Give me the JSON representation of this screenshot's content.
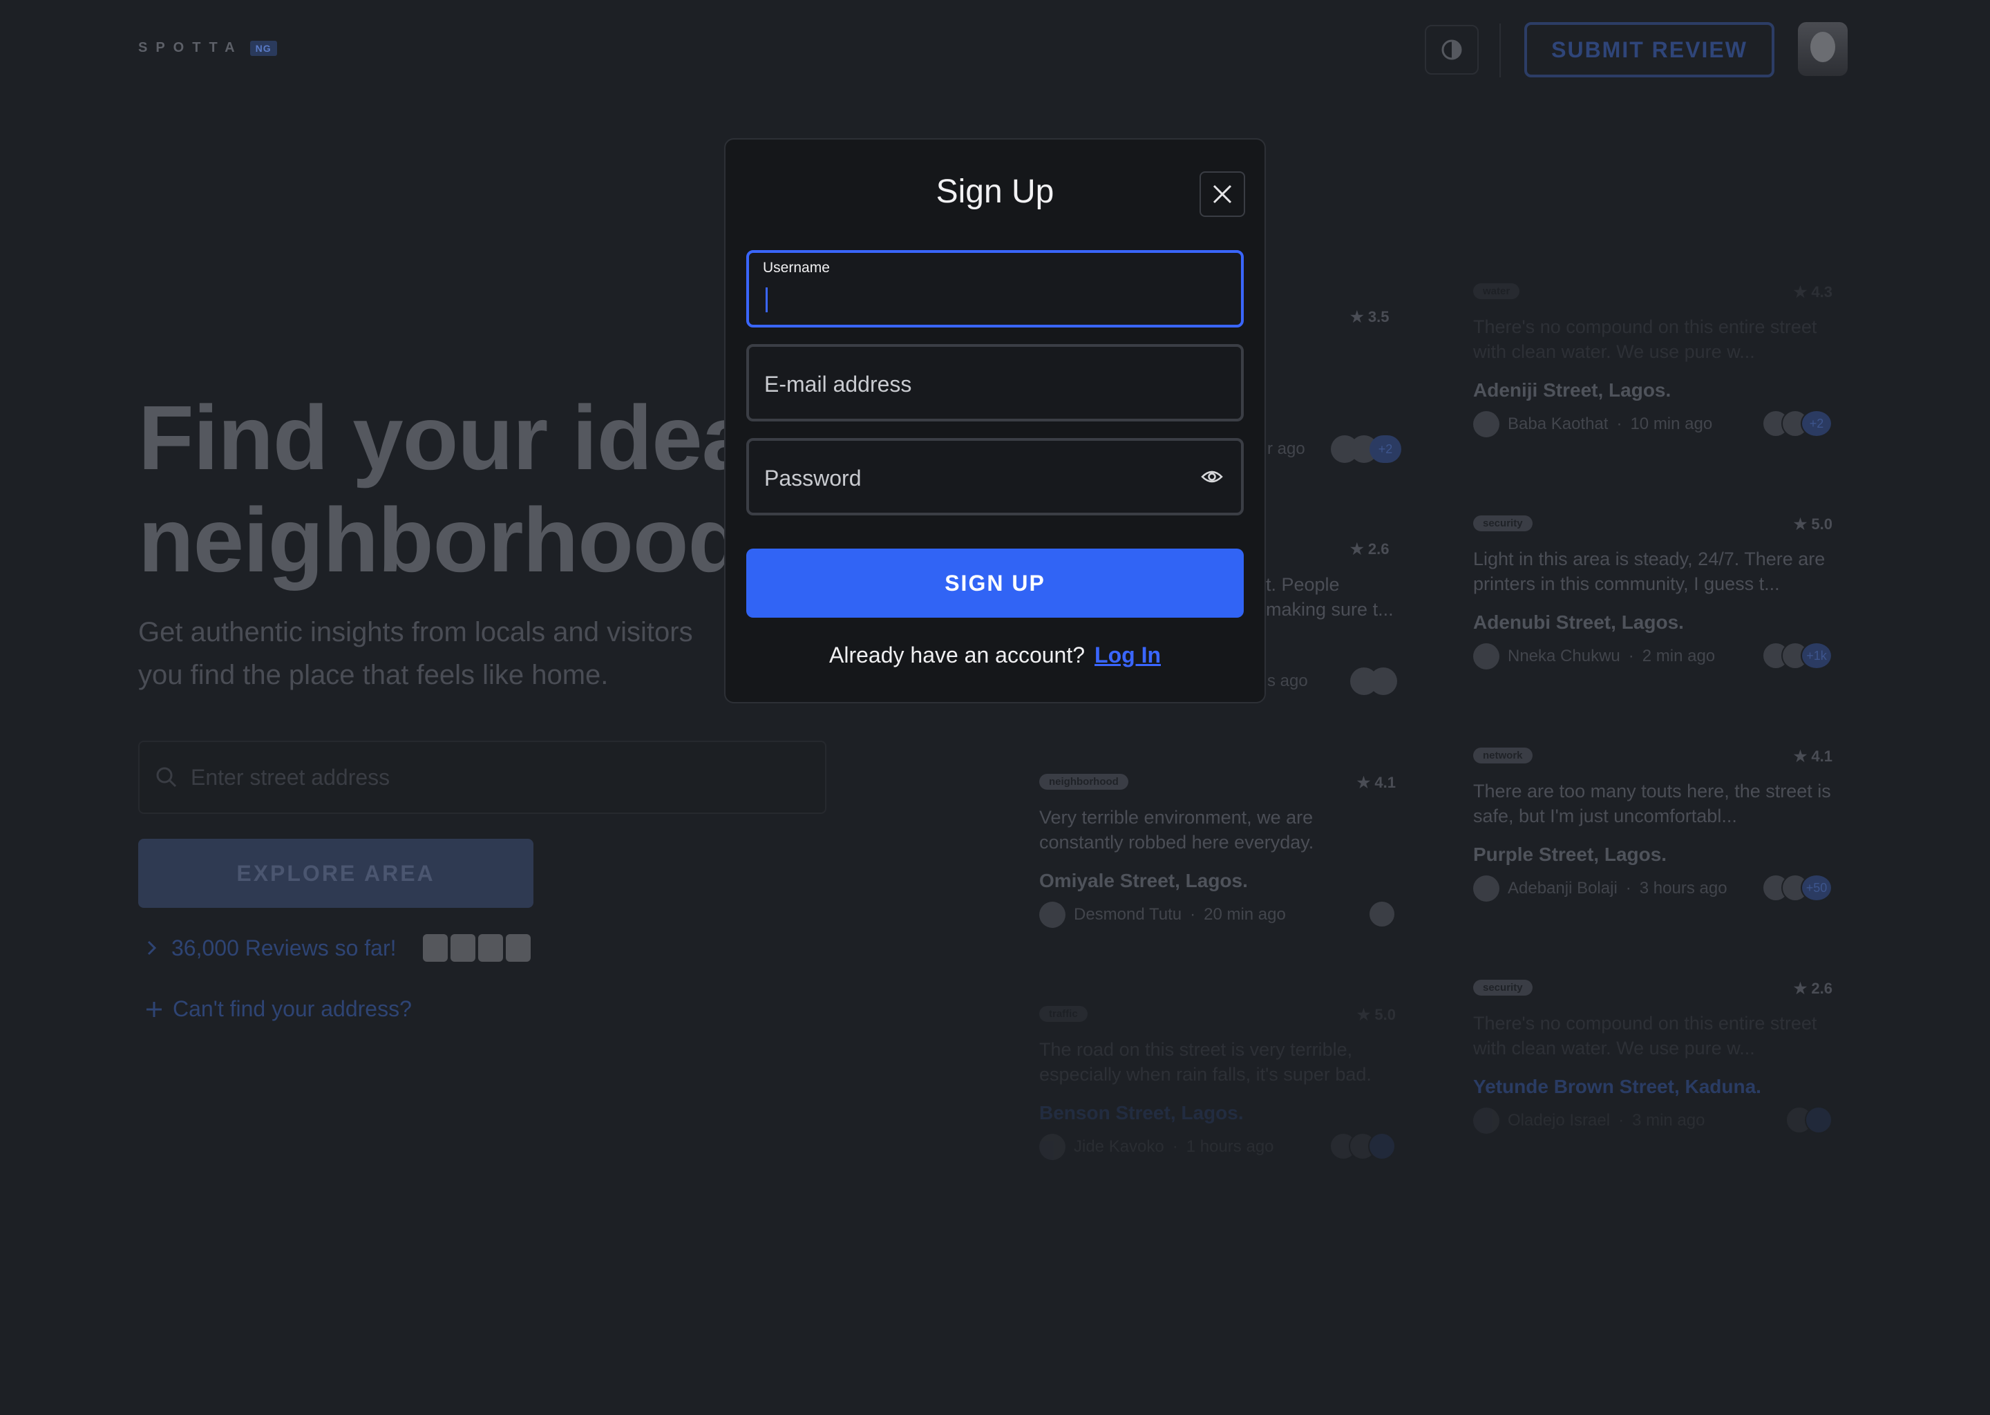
{
  "header": {
    "logo_text": "SPOTTA",
    "logo_tag": "NG",
    "submit_review": "SUBMIT REVIEW"
  },
  "hero": {
    "title_line1": "Find your ideal",
    "title_line2": "neighborhood",
    "subtitle_line1": "Get authentic insights from locals and visitors",
    "subtitle_line2": "you find the place that feels like home.",
    "search_placeholder": "Enter street address",
    "explore_button": "EXPLORE AREA",
    "reviews_count": "36,000 Reviews so far!",
    "cant_find": "Can't find your address?"
  },
  "reviews_middle": [
    {
      "badge": "",
      "rating": "3.5",
      "text": "",
      "street": "",
      "author": "",
      "time": "r ago",
      "extra": "+2"
    },
    {
      "badge": "",
      "rating": "2.6",
      "text": "t. People making sure t...",
      "street": "",
      "author": "",
      "time": "s ago",
      "extra": ""
    },
    {
      "badge": "neighborhood",
      "rating": "4.1",
      "text": "Very terrible environment, we are constantly robbed here everyday.",
      "street": "Omiyale Street, Lagos.",
      "author": "Desmond Tutu",
      "time": "20 min ago",
      "extra": ""
    },
    {
      "badge": "traffic",
      "rating": "5.0",
      "text": "The road on this street is very terrible, especially when rain falls, it's super bad.",
      "street": "Benson Street, Lagos.",
      "author": "Jide Kavoko",
      "time": "1 hours ago",
      "extra": ""
    }
  ],
  "reviews_right": [
    {
      "badge": "water",
      "rating": "4.3",
      "text": "There's no compound on this entire street with clean water. We use pure w...",
      "street": "Adeniji Street, Lagos.",
      "author": "Baba Kaothat",
      "time": "10 min ago",
      "extra": "+2"
    },
    {
      "badge": "security",
      "rating": "5.0",
      "text": "Light in this area is steady, 24/7. There are printers in this community, I guess t...",
      "street": "Adenubi Street, Lagos.",
      "author": "Nneka Chukwu",
      "time": "2 min ago",
      "extra": "+1k"
    },
    {
      "badge": "network",
      "rating": "4.1",
      "text": "There are too many touts here, the street is safe, but I'm just uncomfortabl...",
      "street": "Purple Street, Lagos.",
      "author": "Adebanji Bolaji",
      "time": "3 hours ago",
      "extra": "+50"
    },
    {
      "badge": "security",
      "rating": "2.6",
      "text": "There's no compound on this entire street with clean water. We use pure w...",
      "street": "Yetunde Brown Street, Kaduna.",
      "author": "Oladejo Israel",
      "time": "3 min ago",
      "extra": ""
    }
  ],
  "modal": {
    "title": "Sign Up",
    "username_label": "Username",
    "email_placeholder": "E-mail address",
    "password_placeholder": "Password",
    "signup_button": "SIGN UP",
    "footer_text": "Already have an account?",
    "login_link": "Log In"
  }
}
